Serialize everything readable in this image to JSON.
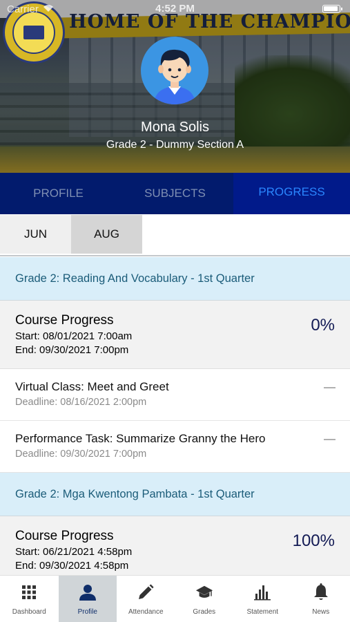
{
  "status_bar": {
    "carrier": "Carrier",
    "time": "4:52 PM"
  },
  "hero": {
    "banner_text": "HOME OF THE CHAMPIONS!"
  },
  "student": {
    "name": "Mona  Solis",
    "section": "Grade 2 - Dummy Section A"
  },
  "tabs": [
    {
      "label": "PROFILE",
      "active": false
    },
    {
      "label": "SUBJECTS",
      "active": false
    },
    {
      "label": "PROGRESS",
      "active": true
    }
  ],
  "months": [
    {
      "label": "JUN",
      "selected": false
    },
    {
      "label": "AUG",
      "selected": true
    }
  ],
  "courses": [
    {
      "header": "Grade 2: Reading And Vocabulary - 1st Quarter",
      "progress": {
        "title": "Course Progress",
        "start": "Start: 08/01/2021 7:00am",
        "end": "End: 09/30/2021 7:00pm",
        "percent": "0%"
      },
      "tasks": [
        {
          "title": "Virtual Class: Meet and Greet",
          "deadline": "Deadline: 08/16/2021 2:00pm"
        },
        {
          "title": "Performance Task: Summarize Granny the Hero",
          "deadline": "Deadline: 09/30/2021 7:00pm"
        }
      ]
    },
    {
      "header": "Grade 2: Mga Kwentong Pambata - 1st Quarter",
      "progress": {
        "title": "Course Progress",
        "start": "Start: 06/21/2021 4:58pm",
        "end": "End: 09/30/2021 4:58pm",
        "percent": "100%"
      },
      "tasks": []
    }
  ],
  "bottom_nav": [
    {
      "label": "Dashboard",
      "icon": "dashboard-grid-icon",
      "active": false
    },
    {
      "label": "Profile",
      "icon": "person-icon",
      "active": true
    },
    {
      "label": "Attendance",
      "icon": "pencil-icon",
      "active": false
    },
    {
      "label": "Grades",
      "icon": "graduation-cap-icon",
      "active": false
    },
    {
      "label": "Statement",
      "icon": "bar-chart-icon",
      "active": false
    },
    {
      "label": "News",
      "icon": "bell-icon",
      "active": false
    }
  ],
  "colors": {
    "tab_bar": "#021b6d",
    "tab_active_text": "#2a86ff",
    "course_header_bg": "#d9eef9",
    "percent_text": "#121a54"
  }
}
